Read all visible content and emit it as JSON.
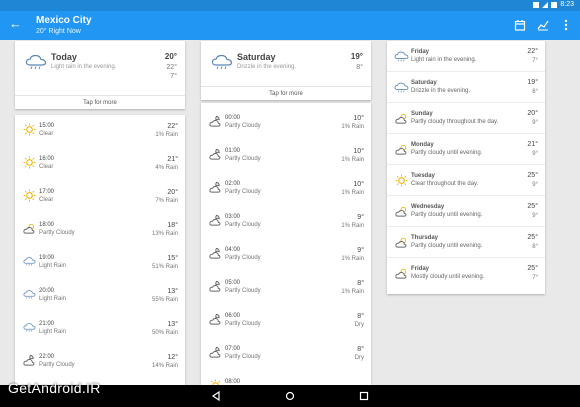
{
  "status_bar": {
    "time": "8:23"
  },
  "app_bar": {
    "title": "Mexico City",
    "subtitle": "20° Right Now",
    "accent": "#2196f3"
  },
  "today_card": {
    "day": "Today",
    "desc": "Light rain in the evening.",
    "hi": "20°",
    "mid": "22°",
    "lo": "7°",
    "tap": "Tap for more",
    "icon": "rain-cloud-icon"
  },
  "today_hours": [
    {
      "time": "15:00",
      "cond": "Clear",
      "temp": "22°",
      "rain": "1% Rain",
      "icon": "sun-icon"
    },
    {
      "time": "16:00",
      "cond": "Clear",
      "temp": "21°",
      "rain": "4% Rain",
      "icon": "sun-icon"
    },
    {
      "time": "17:00",
      "cond": "Clear",
      "temp": "20°",
      "rain": "7% Rain",
      "icon": "sun-icon"
    },
    {
      "time": "18:00",
      "cond": "Partly Cloudy",
      "temp": "18°",
      "rain": "13% Rain",
      "icon": "partly-cloudy-icon"
    },
    {
      "time": "19:00",
      "cond": "Light Rain",
      "temp": "15°",
      "rain": "51% Rain",
      "icon": "rain-cloud-icon"
    },
    {
      "time": "20:00",
      "cond": "Light Rain",
      "temp": "13°",
      "rain": "55% Rain",
      "icon": "rain-cloud-icon"
    },
    {
      "time": "21:00",
      "cond": "Light Rain",
      "temp": "13°",
      "rain": "50% Rain",
      "icon": "rain-cloud-icon"
    },
    {
      "time": "22:00",
      "cond": "Partly Cloudy",
      "temp": "12°",
      "rain": "14% Rain",
      "icon": "partly-cloudy-night-icon"
    }
  ],
  "saturday_card": {
    "day": "Saturday",
    "desc": "Drizzle in the evening.",
    "hi": "19°",
    "lo": "8°",
    "tap": "Tap for more",
    "icon": "rain-cloud-icon"
  },
  "saturday_hours": [
    {
      "time": "00:00",
      "cond": "Partly Cloudy",
      "temp": "10°",
      "rain": "1% Rain"
    },
    {
      "time": "01:00",
      "cond": "Partly Cloudy",
      "temp": "10°",
      "rain": "1% Rain"
    },
    {
      "time": "02:00",
      "cond": "Partly Cloudy",
      "temp": "10°",
      "rain": "1% Rain"
    },
    {
      "time": "03:00",
      "cond": "Partly Cloudy",
      "temp": "9°",
      "rain": "1% Rain"
    },
    {
      "time": "04:00",
      "cond": "Partly Cloudy",
      "temp": "9°",
      "rain": "1% Rain"
    },
    {
      "time": "05:00",
      "cond": "Partly Cloudy",
      "temp": "8°",
      "rain": "1% Rain"
    },
    {
      "time": "06:00",
      "cond": "Partly Cloudy",
      "temp": "8°",
      "rain": "Dry"
    },
    {
      "time": "07:00",
      "cond": "Partly Cloudy",
      "temp": "8°",
      "rain": "Dry"
    },
    {
      "time": "08:00",
      "cond": "",
      "temp": "",
      "rain": ""
    }
  ],
  "forecast": [
    {
      "day": "Friday",
      "desc": "Light rain in the evening.",
      "hi": "22°",
      "lo": "7°",
      "icon": "rain-cloud-icon"
    },
    {
      "day": "Saturday",
      "desc": "Drizzle in the evening.",
      "hi": "19°",
      "lo": "8°",
      "icon": "rain-cloud-icon"
    },
    {
      "day": "Sunday",
      "desc": "Partly cloudy throughout the day.",
      "hi": "20°",
      "lo": "9°",
      "icon": "partly-cloudy-icon"
    },
    {
      "day": "Monday",
      "desc": "Partly cloudy until evening.",
      "hi": "21°",
      "lo": "9°",
      "icon": "partly-cloudy-icon"
    },
    {
      "day": "Tuesday",
      "desc": "Clear throughout the day.",
      "hi": "25°",
      "lo": "9°",
      "icon": "sun-icon"
    },
    {
      "day": "Wednesday",
      "desc": "Partly cloudy until evening.",
      "hi": "25°",
      "lo": "9°",
      "icon": "partly-cloudy-icon"
    },
    {
      "day": "Thursday",
      "desc": "Partly cloudy until evening.",
      "hi": "25°",
      "lo": "8°",
      "icon": "partly-cloudy-icon"
    },
    {
      "day": "Friday",
      "desc": "Mostly cloudy until evening.",
      "hi": "25°",
      "lo": "7°",
      "icon": "partly-cloudy-icon"
    }
  ],
  "watermark": "GetAndroid.IR"
}
